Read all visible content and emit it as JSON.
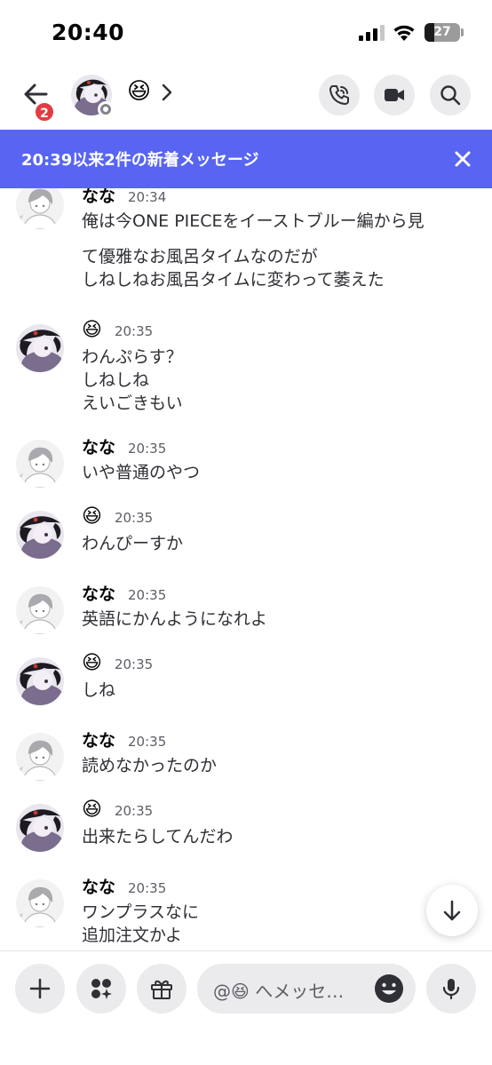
{
  "status_bar": {
    "time": "20:40",
    "battery": "27",
    "battery_level": 0.27
  },
  "header": {
    "unread_badge": "2",
    "name": "😆",
    "icons": {
      "back": "arrow-left-icon",
      "call": "phone-icon",
      "video": "video-camera-icon",
      "search": "search-icon"
    }
  },
  "banner": {
    "text": "20:39以来2件の新着メッセージ",
    "close_icon": "close-icon"
  },
  "messages": [
    {
      "author": "なな",
      "author_type": "text",
      "time": "20:34",
      "lines": [
        "俺は今ONE PIECEをイーストブルー編から見",
        "て優雅なお風呂タイムなのだが",
        "しねしねお風呂タイムに変わって萎えた"
      ]
    },
    {
      "author": "😆",
      "author_type": "emoji",
      "time": "20:35",
      "lines": [
        "わんぷらす？",
        "しねしね",
        "えいごきもい"
      ]
    },
    {
      "author": "なな",
      "author_type": "text",
      "time": "20:35",
      "lines": [
        "いや普通のやつ"
      ]
    },
    {
      "author": "😆",
      "author_type": "emoji",
      "time": "20:35",
      "lines": [
        "わんぴーすか"
      ]
    },
    {
      "author": "なな",
      "author_type": "text",
      "time": "20:35",
      "lines": [
        "英語にかんようになれよ"
      ]
    },
    {
      "author": "😆",
      "author_type": "emoji",
      "time": "20:35",
      "lines": [
        "しね"
      ]
    },
    {
      "author": "なな",
      "author_type": "text",
      "time": "20:35",
      "lines": [
        "読めなかったのか"
      ]
    },
    {
      "author": "😆",
      "author_type": "emoji",
      "time": "20:35",
      "lines": [
        "出来たらしてんだわ"
      ]
    },
    {
      "author": "なな",
      "author_type": "text",
      "time": "20:35",
      "lines": [
        "ワンプラスなに",
        "追加注文かよ"
      ]
    }
  ],
  "composer": {
    "placeholder": "@😆 へメッセ…",
    "icons": {
      "add": "plus-icon",
      "apps": "apps-icon",
      "gift": "gift-icon",
      "emoji": "emoji-icon",
      "voice": "microphone-icon"
    }
  },
  "colors": {
    "banner": "#5865f2",
    "badge": "#e33b42",
    "button_bg": "#ebebed"
  }
}
